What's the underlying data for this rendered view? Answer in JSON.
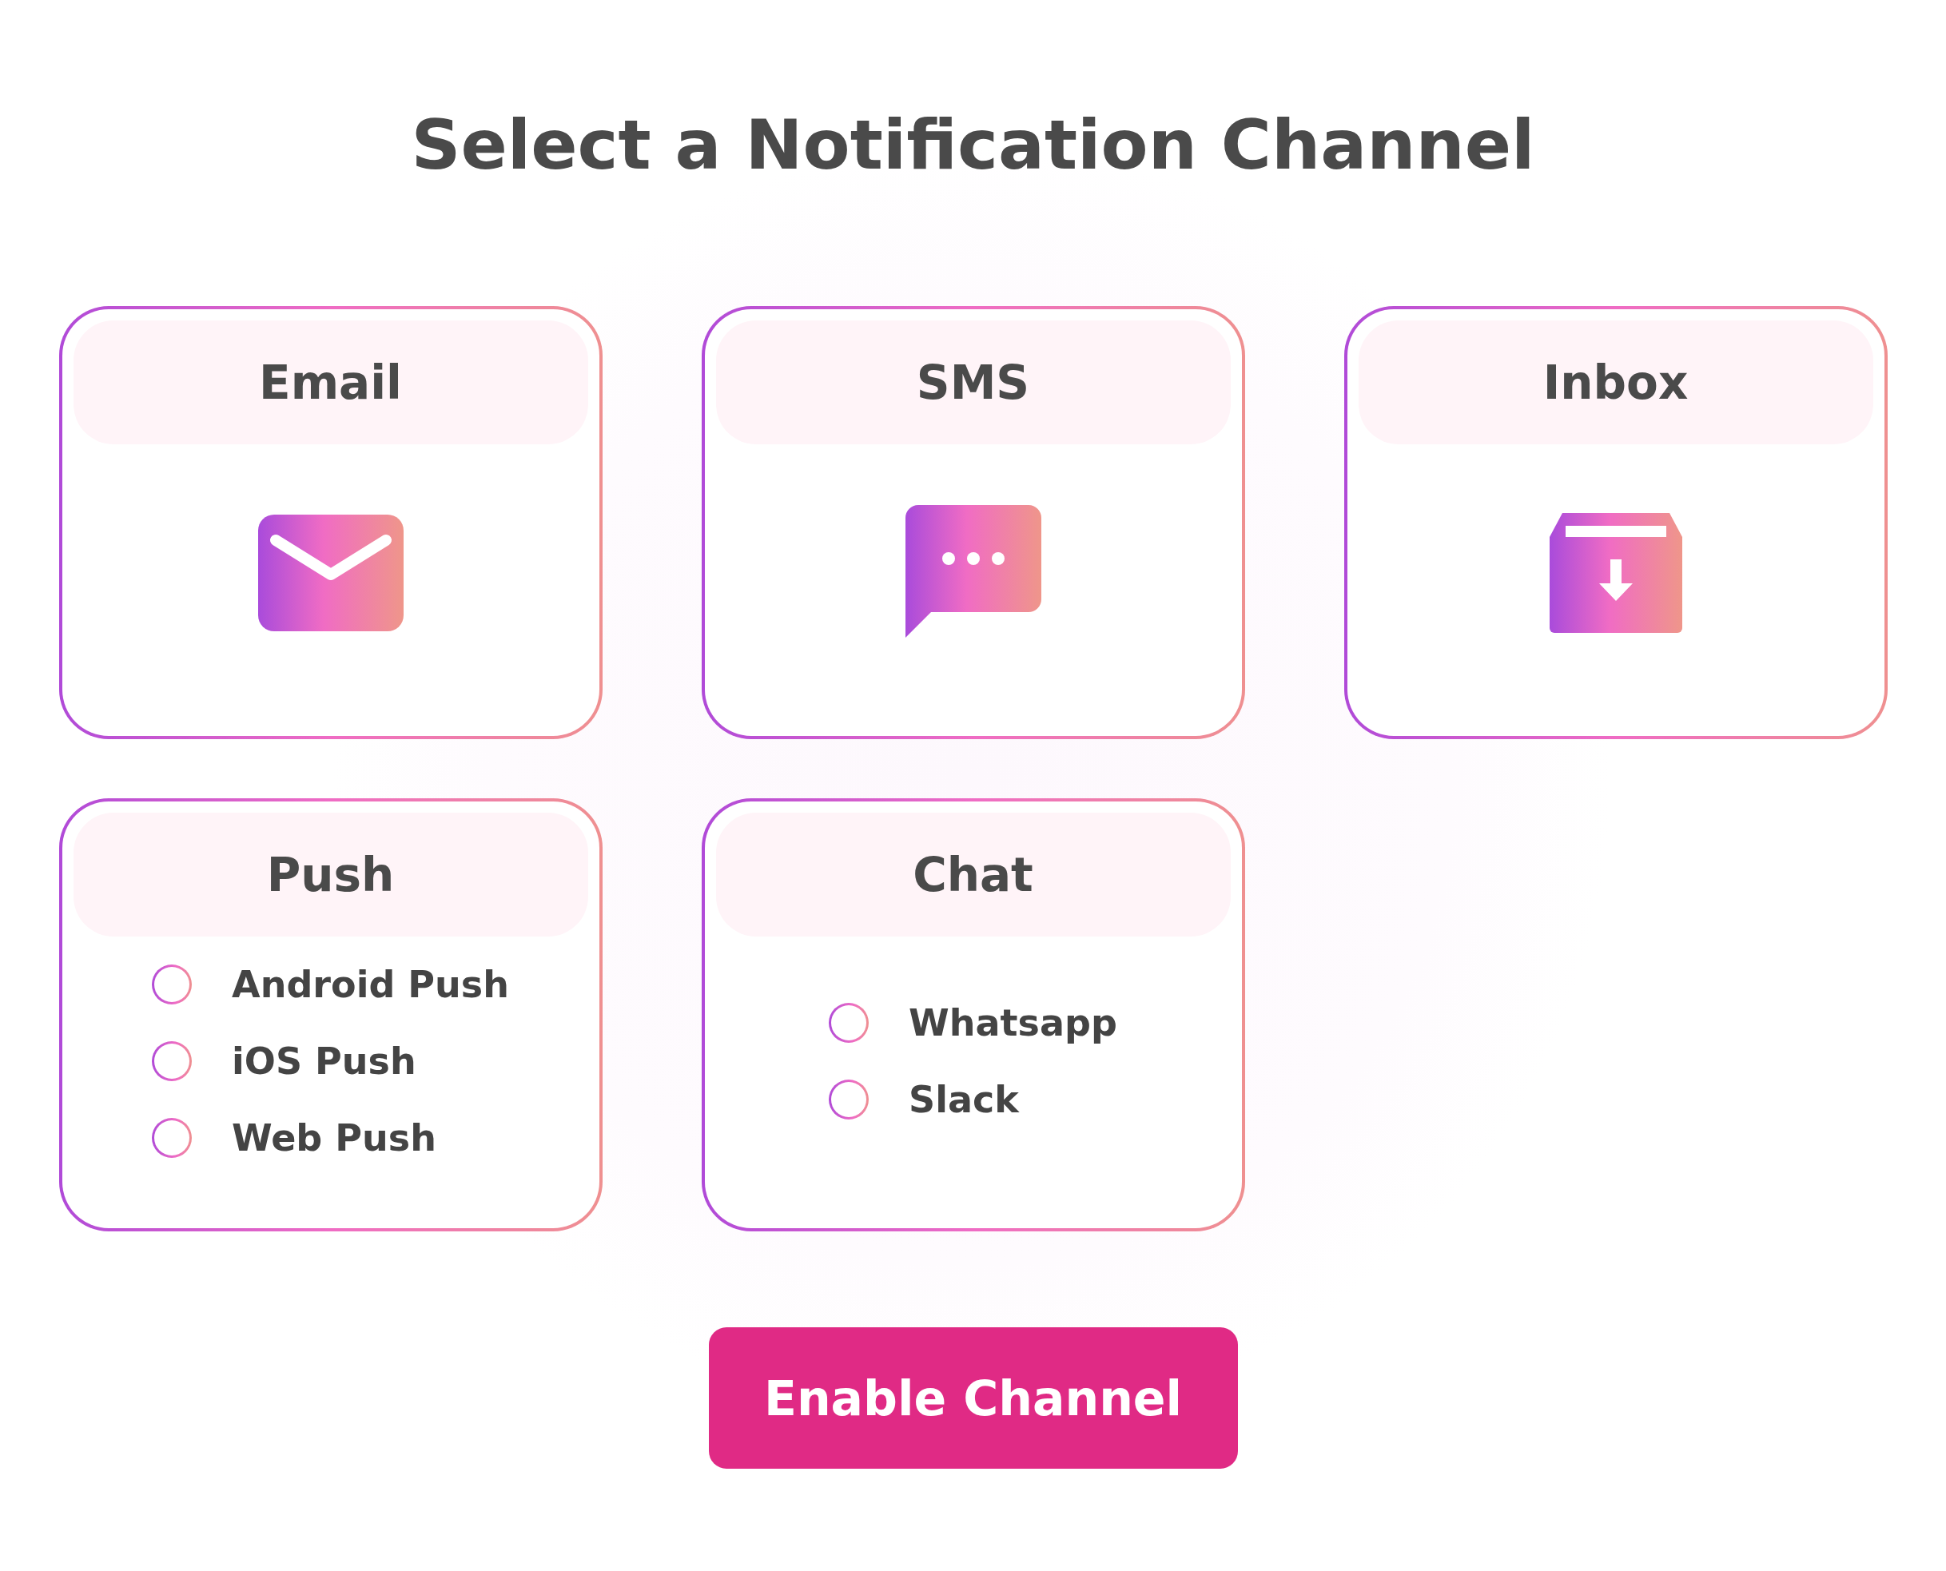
{
  "title": "Select a Notification Channel",
  "channels": [
    {
      "kind": "icon",
      "name": "Email"
    },
    {
      "kind": "icon",
      "name": "SMS"
    },
    {
      "kind": "icon",
      "name": "Inbox"
    },
    {
      "kind": "options",
      "name": "Push",
      "options": [
        {
          "label": "Android Push",
          "selected": false
        },
        {
          "label": "iOS Push",
          "selected": false
        },
        {
          "label": "Web Push",
          "selected": false
        }
      ]
    },
    {
      "kind": "options",
      "name": "Chat",
      "options": [
        {
          "label": "Whatsapp",
          "selected": false
        },
        {
          "label": "Slack",
          "selected": false
        }
      ]
    }
  ],
  "button": "Enable Channel"
}
